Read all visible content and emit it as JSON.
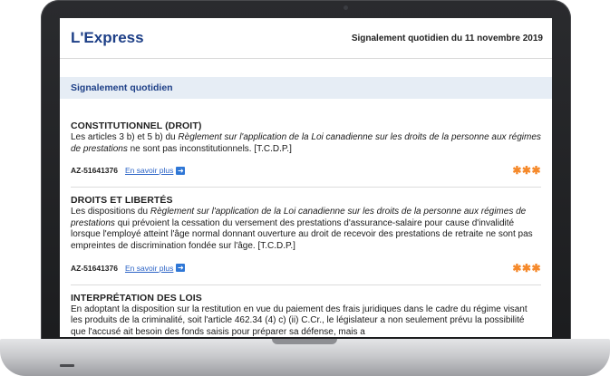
{
  "header": {
    "logo": "L'Express",
    "date_text": "Signalement quotidien du 11 novembre 2019"
  },
  "section": {
    "title": "Signalement quotidien"
  },
  "articles": [
    {
      "heading": "CONSTITUTIONNEL (DROIT)",
      "body_prefix": "Les articles 3 b) et 5 b) du ",
      "body_italic": "Règlement sur l'application de la Loi canadienne sur les droits de la personne aux régimes de prestations",
      "body_suffix": " ne sont pas inconstitutionnels. [T.C.D.P.]",
      "reference": "AZ-51641376",
      "link_label": "En savoir plus",
      "stars": "✱✱✱"
    },
    {
      "heading": "DROITS ET LIBERTÉS",
      "body_prefix": "Les dispositions du ",
      "body_italic": "Règlement sur l'application de la Loi canadienne sur les droits de la personne aux régimes de prestations",
      "body_suffix": " qui prévoient la cessation du versement des prestations d'assurance-salaire pour cause d'invalidité lorsque l'employé atteint l'âge normal donnant ouverture au droit de recevoir des prestations de retraite ne sont pas empreintes de discrimination fondée sur l'âge. [T.C.D.P.]",
      "reference": "AZ-51641376",
      "link_label": "En savoir plus",
      "stars": "✱✱✱"
    },
    {
      "heading": "INTERPRÉTATION DES LOIS",
      "body": "En adoptant la disposition sur la restitution en vue du paiement des frais juridiques dans le cadre du régime visant les produits de la criminalité, soit l'article 462.34 (4) c) (ii) C.Cr., le législateur a non seulement prévu la possibilité que l'accusé ait besoin des fonds saisis pour préparer sa défense, mais a"
    }
  ],
  "colors": {
    "brand": "#1d3f87",
    "link": "#2b63c6",
    "stars": "#f5892b",
    "section_bg": "#e6edf5"
  }
}
